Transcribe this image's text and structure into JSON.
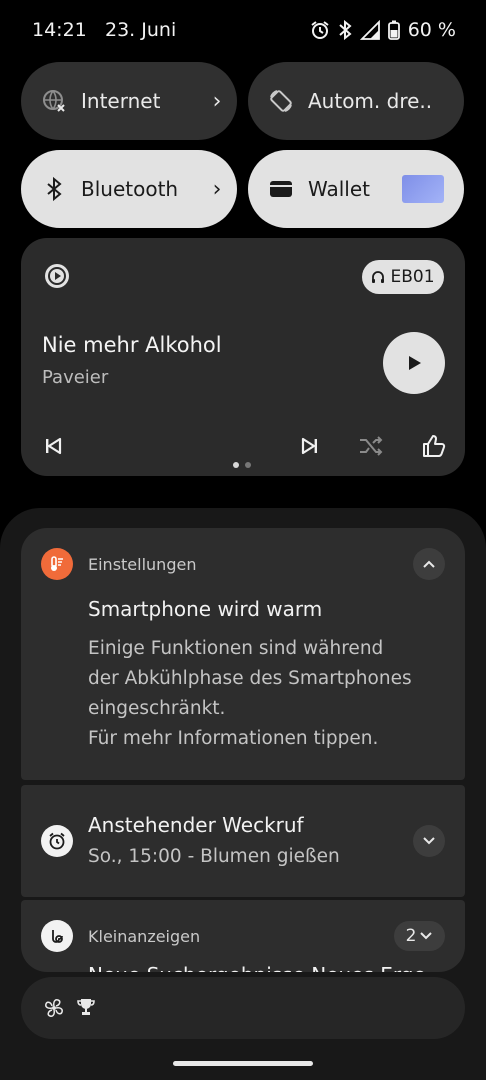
{
  "status": {
    "time": "14:21",
    "date": "23. Juni",
    "battery": "60 %"
  },
  "tiles": [
    {
      "label": "Internet",
      "icon": "globe-icon"
    },
    {
      "label": "Autom. dre..",
      "icon": "rotate-icon"
    },
    {
      "label": "Bluetooth",
      "icon": "bluetooth-icon"
    },
    {
      "label": "Wallet",
      "icon": "wallet-icon"
    }
  ],
  "media": {
    "device": "EB01",
    "title": "Nie mehr Alkohol",
    "artist": "Paveier"
  },
  "notifications": {
    "warm": {
      "app": "Einstellungen",
      "title": "Smartphone wird warm",
      "body_lines": [
        "Einige Funktionen sind während",
        "der Abkühlphase des Smartphones",
        "eingeschränkt.",
        "Für mehr Informationen tippen."
      ]
    },
    "alarm": {
      "title": "Anstehender Weckruf",
      "text": "So., 15:00 - Blumen gießen"
    },
    "kleinanzeigen": {
      "app": "Kleinanzeigen",
      "count": "2",
      "peek": "Neue Suchergebnisse Neues Erge"
    }
  },
  "colors": {
    "accent_orange": "#f06b3a",
    "tile_light": "#e2e2e2",
    "tile_dark": "#303030"
  }
}
